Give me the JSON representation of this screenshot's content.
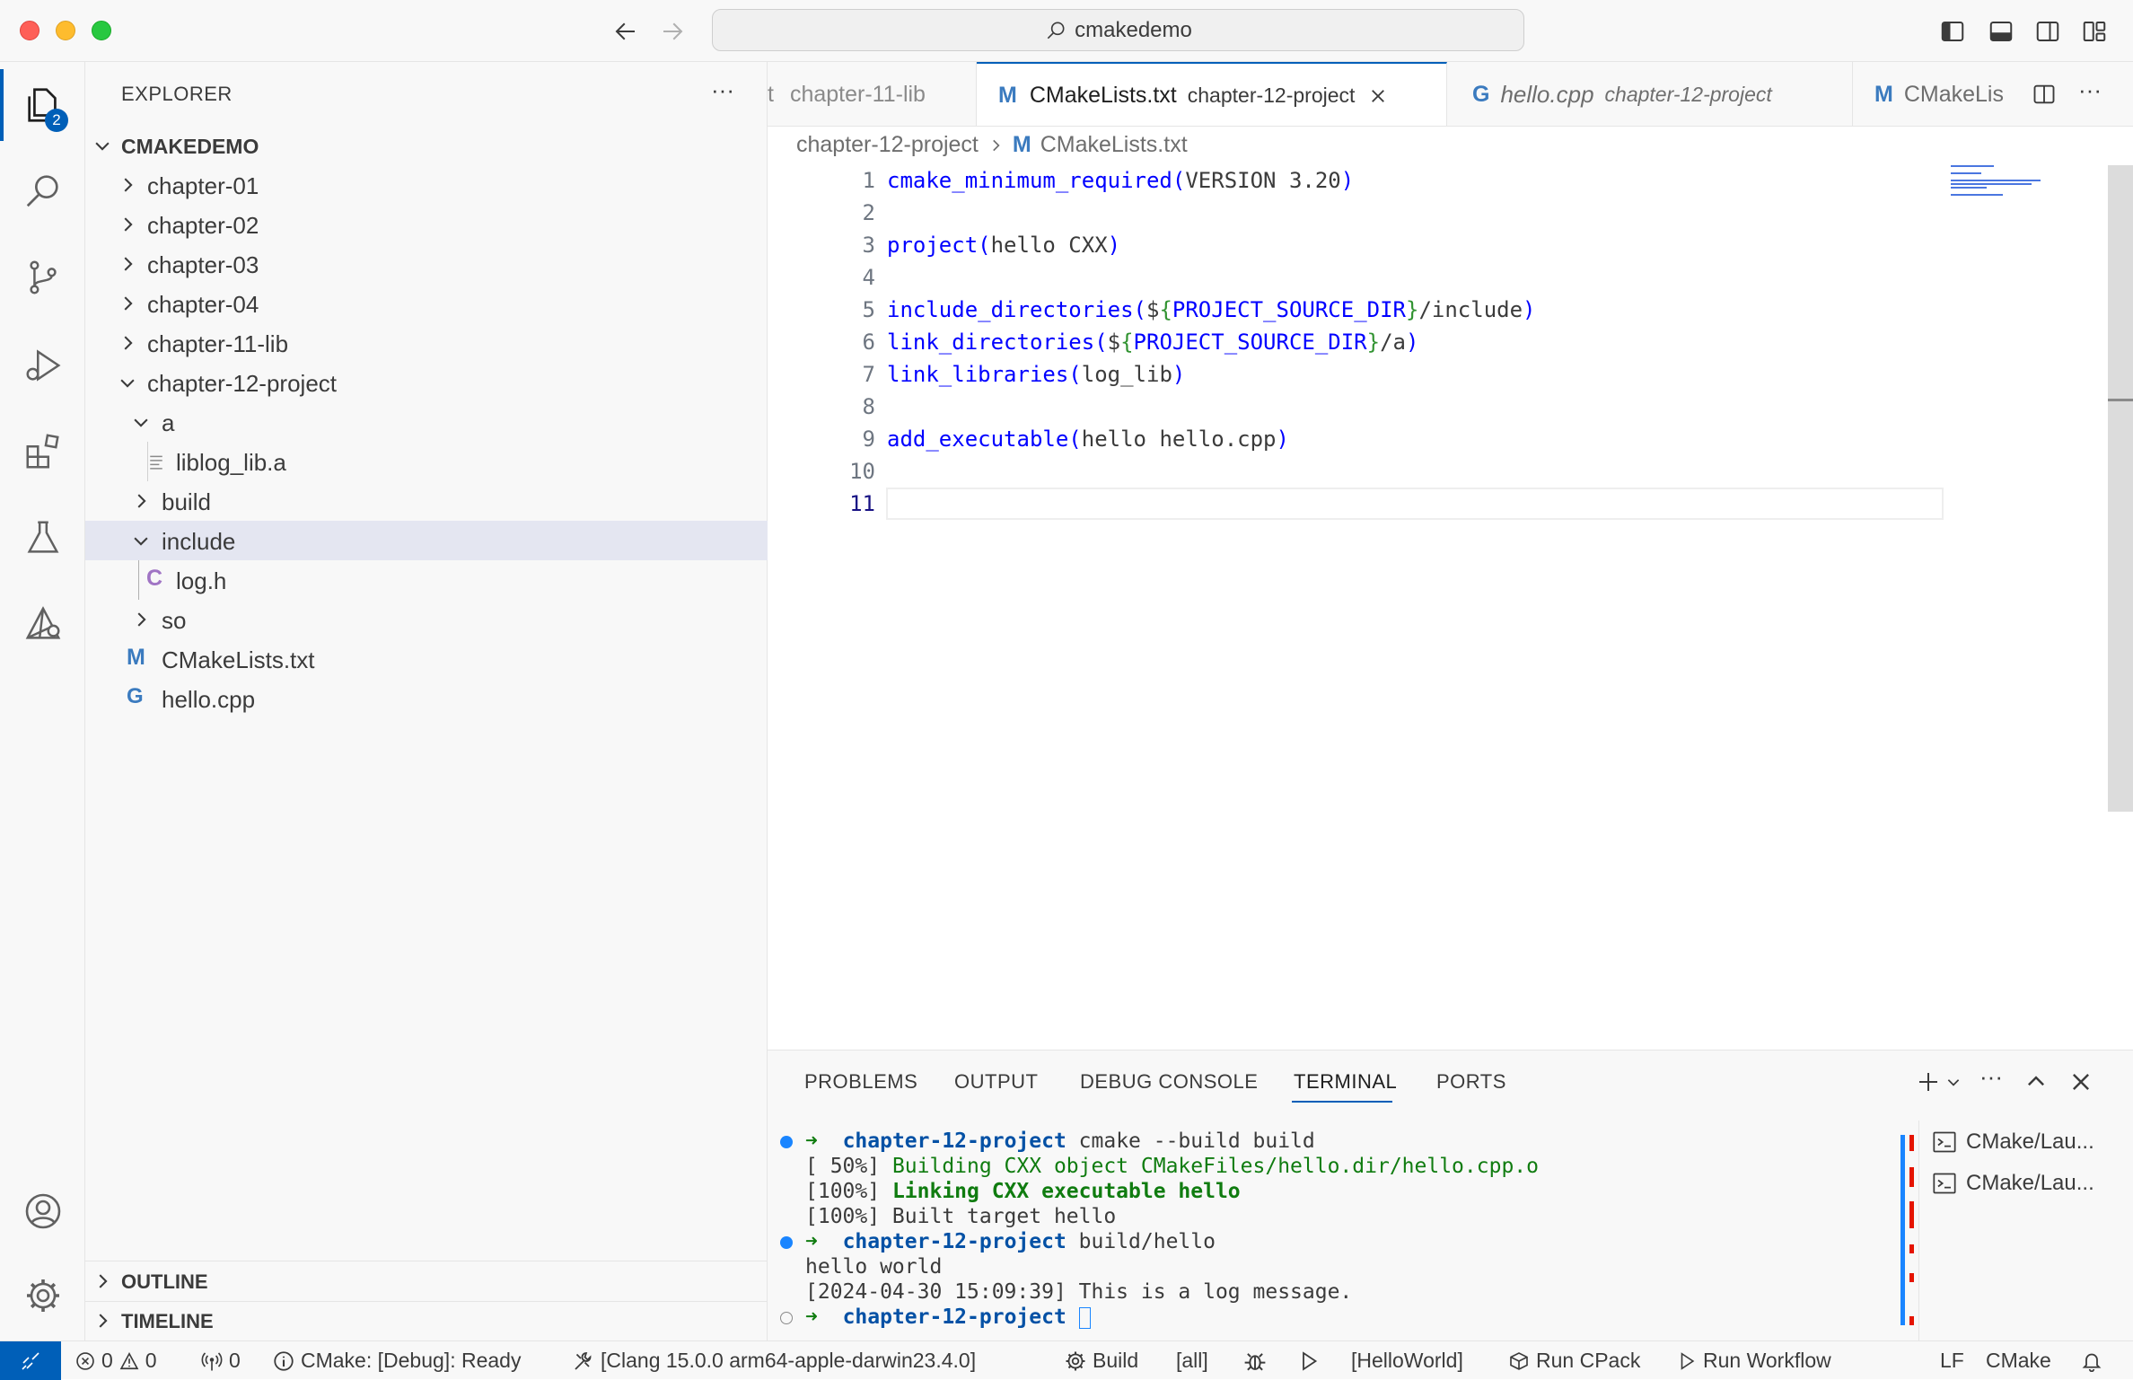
{
  "window": {
    "title": "cmakedemo"
  },
  "activity_bar": {
    "explorer_badge": "2"
  },
  "sidebar": {
    "title": "EXPLORER",
    "more": "···",
    "root": "CMAKEDEMO",
    "items": [
      {
        "label": "chapter-01",
        "kind": "folder-collapsed"
      },
      {
        "label": "chapter-02",
        "kind": "folder-collapsed"
      },
      {
        "label": "chapter-03",
        "kind": "folder-collapsed"
      },
      {
        "label": "chapter-04",
        "kind": "folder-collapsed"
      },
      {
        "label": "chapter-11-lib",
        "kind": "folder-collapsed"
      },
      {
        "label": "chapter-12-project",
        "kind": "folder-expanded"
      },
      {
        "label": "a",
        "kind": "folder-expanded"
      },
      {
        "label": "liblog_lib.a",
        "kind": "file"
      },
      {
        "label": "build",
        "kind": "folder-collapsed"
      },
      {
        "label": "include",
        "kind": "folder-expanded"
      },
      {
        "label": "log.h",
        "kind": "c-file"
      },
      {
        "label": "so",
        "kind": "folder-collapsed"
      },
      {
        "label": "CMakeLists.txt",
        "kind": "cmake-file"
      },
      {
        "label": "hello.cpp",
        "kind": "cpp-file"
      }
    ],
    "outline": "OUTLINE",
    "timeline": "TIMELINE"
  },
  "tabs": [
    {
      "name": "t",
      "desc": "chapter-11-lib"
    },
    {
      "name": "CMakeLists.txt",
      "desc": "chapter-12-project",
      "active": true
    },
    {
      "name": "hello.cpp",
      "desc": "chapter-12-project"
    },
    {
      "name": "CMakeLis",
      "desc": ""
    }
  ],
  "breadcrumb": {
    "folder": "chapter-12-project",
    "file": "CMakeLists.txt"
  },
  "code": {
    "line_numbers": [
      "1",
      "2",
      "3",
      "4",
      "5",
      "6",
      "7",
      "8",
      "9",
      "10",
      "11"
    ],
    "l1_fn": "cmake_minimum_required",
    "l1_open": "(",
    "l1_args": "VERSION 3.20",
    "l1_close": ")",
    "l3_fn": "project",
    "l3_open": "(",
    "l3_args": "hello CXX",
    "l3_close": ")",
    "l5_fn": "include_directories",
    "l5_open": "(",
    "l5_dollar": "$",
    "l5_b1": "{",
    "l5_var": "PROJECT_SOURCE_DIR",
    "l5_b2": "}",
    "l5_rest": "/include",
    "l5_close": ")",
    "l6_fn": "link_directories",
    "l6_open": "(",
    "l6_dollar": "$",
    "l6_b1": "{",
    "l6_var": "PROJECT_SOURCE_DIR",
    "l6_b2": "}",
    "l6_rest": "/a",
    "l6_close": ")",
    "l7_fn": "link_libraries",
    "l7_open": "(",
    "l7_args": "log_lib",
    "l7_close": ")",
    "l9_fn": "add_executable",
    "l9_open": "(",
    "l9_args": "hello hello.cpp",
    "l9_close": ")"
  },
  "panel": {
    "tabs": [
      "PROBLEMS",
      "OUTPUT",
      "DEBUG CONSOLE",
      "TERMINAL",
      "PORTS"
    ],
    "active_tab": "TERMINAL",
    "terminal_lines": {
      "l1_arrow": "➜",
      "l1_dir": "chapter-12-project",
      "l1_cmd": " cmake --build build",
      "l2_pre": "[ 50%] ",
      "l2_msg": "Building CXX object CMakeFiles/hello.dir/hello.cpp.o",
      "l3_pre": "[100%] ",
      "l3_msg": "Linking CXX executable hello",
      "l4": "[100%] Built target hello",
      "l5_arrow": "➜",
      "l5_dir": "chapter-12-project",
      "l5_cmd": " build/hello",
      "l6": "hello world",
      "l7": "[2024-04-30 15:09:39] This is a log message.",
      "l8_arrow": "➜",
      "l8_dir": "chapter-12-project"
    },
    "terminals": [
      "CMake/Lau...",
      "CMake/Lau..."
    ]
  },
  "status": {
    "errors": "0",
    "warnings": "0",
    "ports": "0",
    "cmake_status": "CMake: [Debug]: Ready",
    "kit": "[Clang 15.0.0 arm64-apple-darwin23.4.0]",
    "build": "Build",
    "target": "[all]",
    "launch_target": "[HelloWorld]",
    "cpack": "Run CPack",
    "workflow": "Run Workflow",
    "eol": "LF",
    "language": "CMake"
  },
  "colors": {
    "accent": "#005fb8",
    "cmake_icon": "#3b7bbf",
    "selection": "#e4e6f1"
  }
}
